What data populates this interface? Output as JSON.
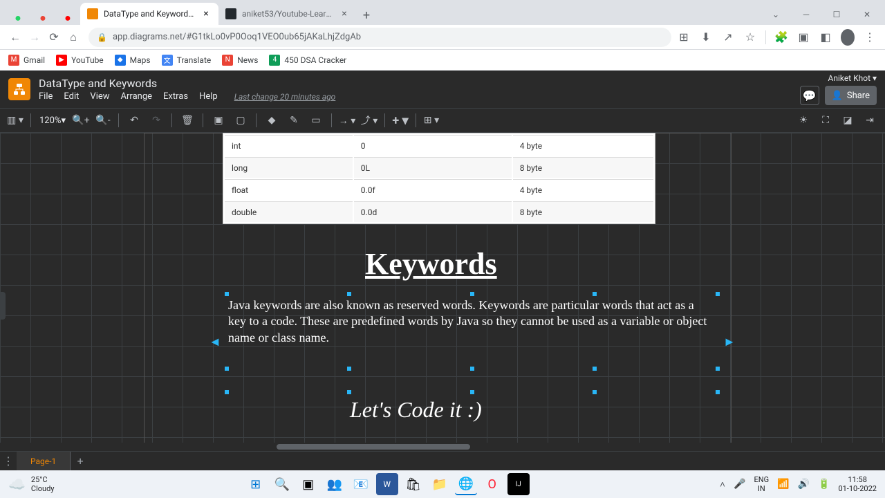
{
  "browser": {
    "tabs": [
      {
        "title": "DataType and Keywords - diagra",
        "active": true
      },
      {
        "title": "aniket53/Youtube-Learn-Java",
        "active": false
      }
    ],
    "url": "app.diagrams.net/#G1tkLo0vP0Ooq1VEO0ub65jAKaLhjZdgAb"
  },
  "bookmarks": [
    {
      "label": "Gmail",
      "color": "#ea4335"
    },
    {
      "label": "YouTube",
      "color": "#ff0000"
    },
    {
      "label": "Maps",
      "color": "#1a73e8"
    },
    {
      "label": "Translate",
      "color": "#4285f4"
    },
    {
      "label": "News",
      "color": "#ea4335"
    },
    {
      "label": "450 DSA Cracker",
      "color": "#0f9d58"
    }
  ],
  "app": {
    "title": "DataType and Keywords",
    "menus": [
      "File",
      "Edit",
      "View",
      "Arrange",
      "Extras",
      "Help"
    ],
    "last_change": "Last change 20 minutes ago",
    "user": "Aniket Khot",
    "share": "Share",
    "zoom": "120%",
    "page_tab": "Page-1"
  },
  "table": {
    "rows": [
      {
        "c1": "int",
        "c2": "0",
        "c3": "4 byte"
      },
      {
        "c1": "long",
        "c2": "0L",
        "c3": "8 byte"
      },
      {
        "c1": "float",
        "c2": "0.0f",
        "c3": "4 byte"
      },
      {
        "c1": "double",
        "c2": "0.0d",
        "c3": "8 byte"
      }
    ]
  },
  "content": {
    "heading": "Keywords",
    "paragraph": "Java keywords are also known as reserved words. Keywords are particular words that act as a key to a code. These are predefined words by Java so they cannot be used as a variable or object name or class name.",
    "lets_code": "Let's Code it :)"
  },
  "taskbar": {
    "temp": "25°C",
    "weather": "Cloudy",
    "lang": "ENG",
    "locale": "IN",
    "time": "11:58",
    "date": "01-10-2022"
  }
}
